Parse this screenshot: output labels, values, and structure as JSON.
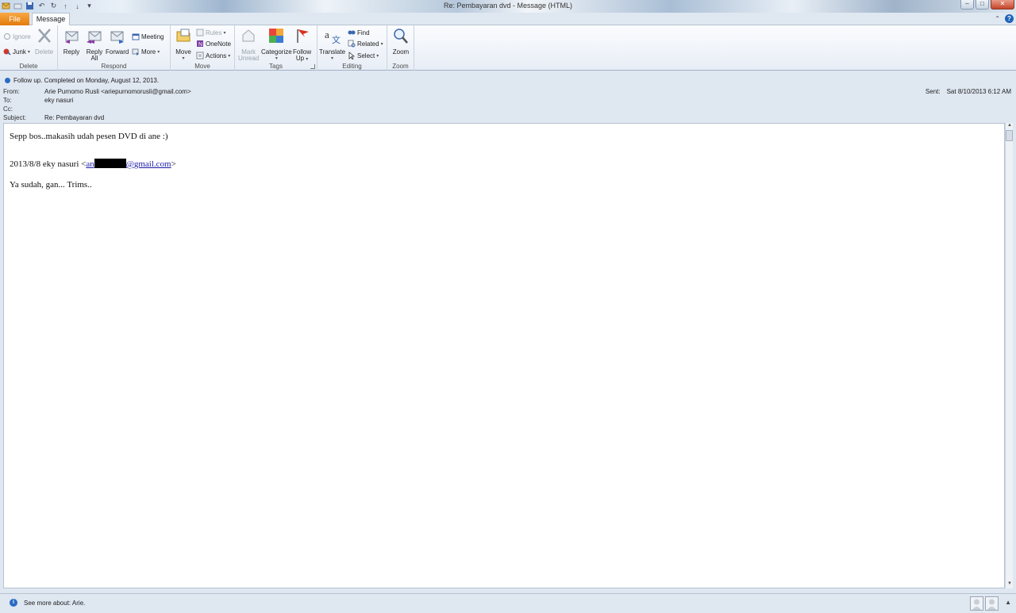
{
  "window": {
    "title": "Re: Pembayaran dvd - Message (HTML)"
  },
  "tabs": {
    "file": "File",
    "message": "Message"
  },
  "ribbon": {
    "delete_group": {
      "label": "Delete",
      "ignore": "Ignore",
      "junk": "Junk",
      "delete": "Delete"
    },
    "respond_group": {
      "label": "Respond",
      "reply": "Reply",
      "reply_all_line1": "Reply",
      "reply_all_line2": "All",
      "forward": "Forward",
      "meeting": "Meeting",
      "more": "More"
    },
    "move_group": {
      "label": "Move",
      "move": "Move",
      "rules": "Rules",
      "onenote": "OneNote",
      "actions": "Actions"
    },
    "tags_group": {
      "label": "Tags",
      "mark_unread_line1": "Mark",
      "mark_unread_line2": "Unread",
      "categorize": "Categorize",
      "follow_up_line1": "Follow",
      "follow_up_line2": "Up"
    },
    "editing_group": {
      "label": "Editing",
      "translate": "Translate",
      "find": "Find",
      "related": "Related",
      "select": "Select"
    },
    "zoom_group": {
      "label": "Zoom",
      "zoom": "Zoom"
    }
  },
  "header": {
    "info": "Follow up.  Completed on Monday, August 12, 2013.",
    "from_label": "From:",
    "from_value": "Arie Purnomo Rusli <ariepurnomorusli@gmail.com>",
    "to_label": "To:",
    "to_value": "eky nasuri",
    "cc_label": "Cc:",
    "cc_value": "",
    "subject_label": "Subject:",
    "subject_value": "Re: Pembayaran dvd",
    "sent_label": "Sent:",
    "sent_value": "Sat 8/10/2013 6:12 AM"
  },
  "body": {
    "line1": "Sepp bos..makasih udah pesen DVD di ane :)",
    "quote_prefix": "2013/8/8 eky nasuri <",
    "email_start": "an",
    "email_end": "@gmail.com",
    "quote_suffix": ">",
    "line3": "Ya sudah, gan... Trims.."
  },
  "status": {
    "text": "See more about: Arie."
  },
  "colors": {
    "file_tab": "#e37b0c",
    "link": "#1a1aa6",
    "info_icon": "#2a6bc4"
  }
}
